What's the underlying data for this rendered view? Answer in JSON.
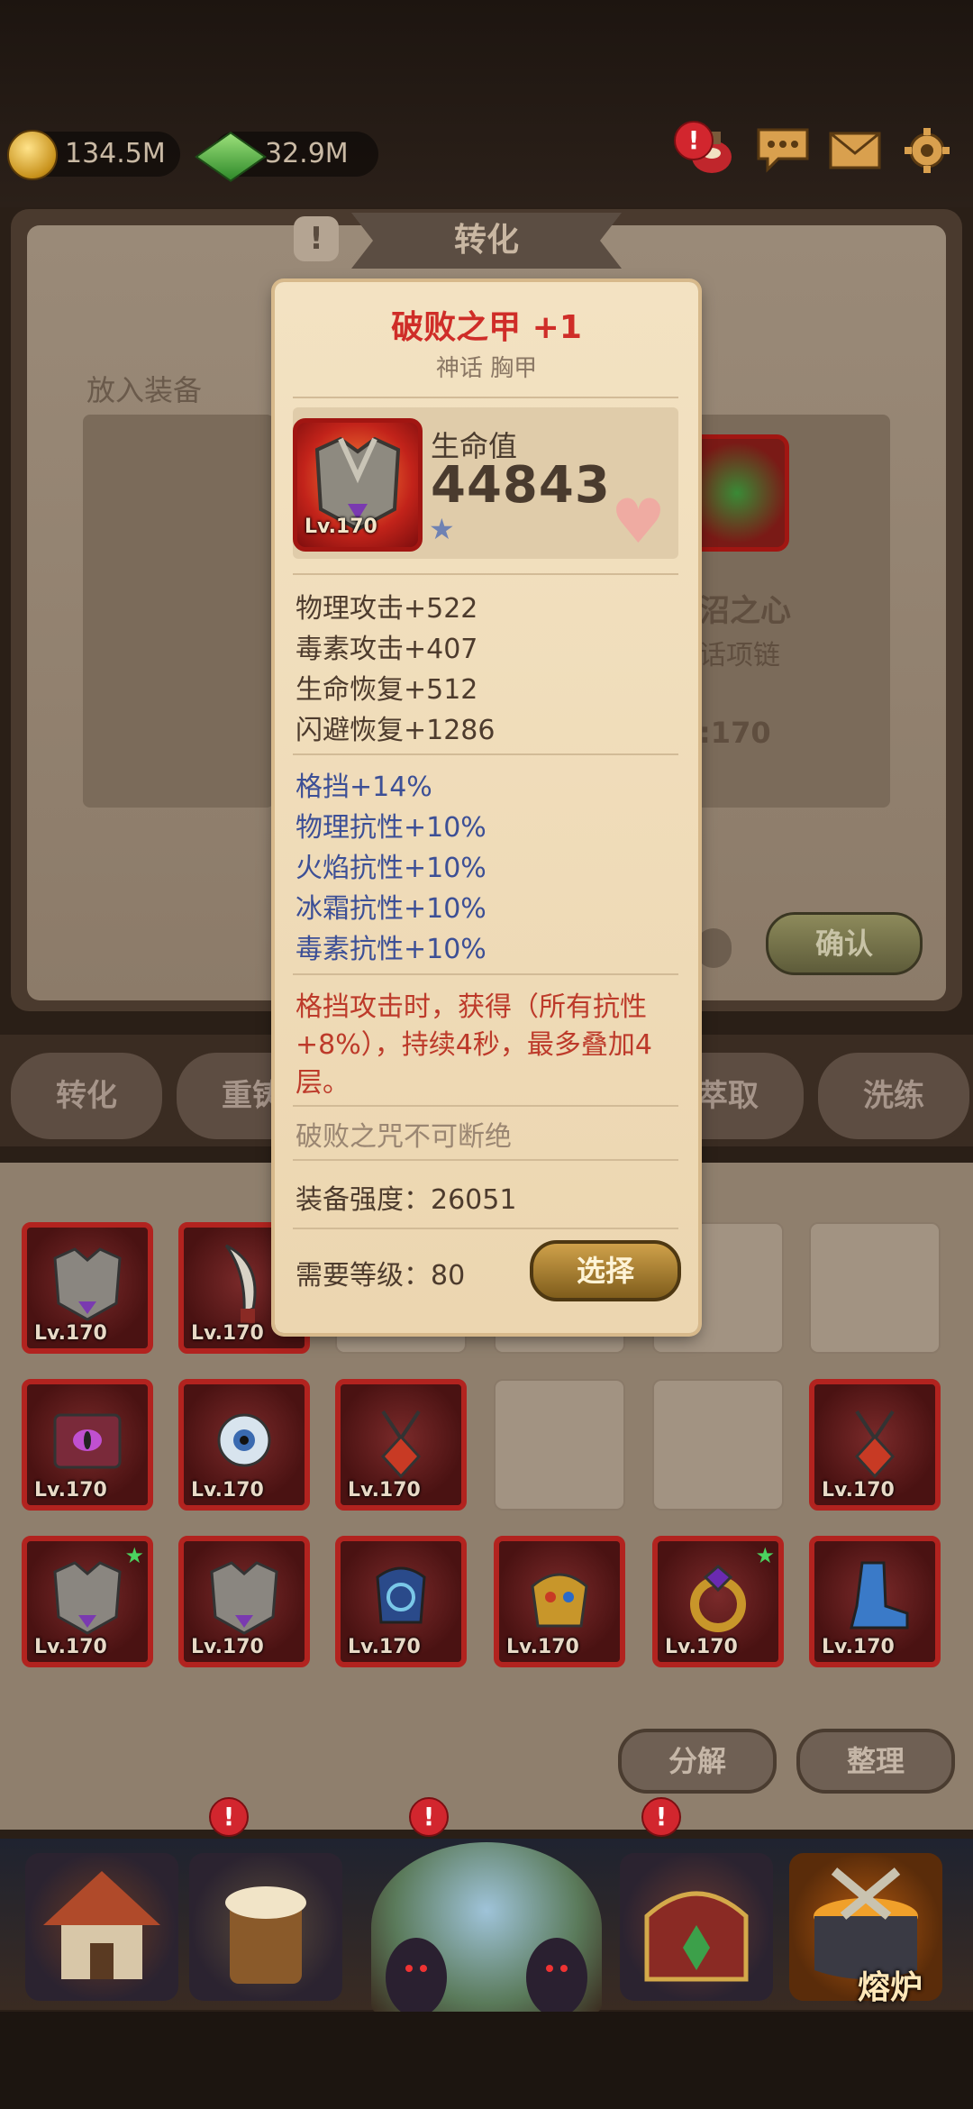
{
  "resources": {
    "gold": "134.5M",
    "gems": "32.9M"
  },
  "header": {
    "title": "转化"
  },
  "left_panel": {
    "place_label": "放入装备"
  },
  "right_panel": {
    "name": "沼之心",
    "type": "话项链",
    "level": ":170",
    "confirm_label": "确认"
  },
  "tabs": [
    "转化",
    "重铸",
    "萃取",
    "洗练"
  ],
  "popup": {
    "title": "破败之甲 +1",
    "subtitle": "神话 胸甲",
    "item_level": "Lv.170",
    "stat_label": "生命值",
    "stat_value": "44843",
    "basic_stats": [
      "物理攻击+522",
      "毒素攻击+407",
      "生命恢复+512",
      "闪避恢复+1286"
    ],
    "bonus_stats": [
      "格挡+14%",
      "物理抗性+10%",
      "火焰抗性+10%",
      "冰霜抗性+10%",
      "毒素抗性+10%"
    ],
    "effect_lines": [
      "格挡攻击时，获得（所有抗性",
      "+8%），持续4秒，最多叠加4",
      "层。"
    ],
    "flavor": "破败之咒不可断绝",
    "power": "装备强度：26051",
    "required_level": "需要等级：80",
    "select_label": "选择"
  },
  "inventory": {
    "rows": [
      [
        {
          "level": "Lv.170",
          "icon": "armor-icon"
        },
        {
          "level": "Lv.170",
          "icon": "blade-icon"
        },
        null,
        null,
        null,
        null
      ],
      [
        {
          "level": "Lv.170",
          "icon": "book-icon"
        },
        {
          "level": "Lv.170",
          "icon": "eye-icon"
        },
        {
          "level": "Lv.170",
          "icon": "amulet-icon"
        },
        null,
        null,
        {
          "level": "Lv.170",
          "icon": "amulet-icon"
        }
      ],
      [
        {
          "level": "Lv.170",
          "icon": "armor-icon",
          "star": true
        },
        {
          "level": "Lv.170",
          "icon": "armor-icon"
        },
        {
          "level": "Lv.170",
          "icon": "gloves-icon"
        },
        {
          "level": "Lv.170",
          "icon": "gauntlet-icon"
        },
        {
          "level": "Lv.170",
          "icon": "ring-icon",
          "star": true
        },
        {
          "level": "Lv.170",
          "icon": "boot-icon"
        }
      ]
    ],
    "decompose_label": "分解",
    "sort_label": "整理"
  },
  "bottom_nav": {
    "active_label": "熔炉"
  },
  "colors": {
    "rarity_red": "#b2231f",
    "title_red": "#cf2d28",
    "bonus_blue": "#3c4f96",
    "effect_red": "#bd3a2a"
  }
}
